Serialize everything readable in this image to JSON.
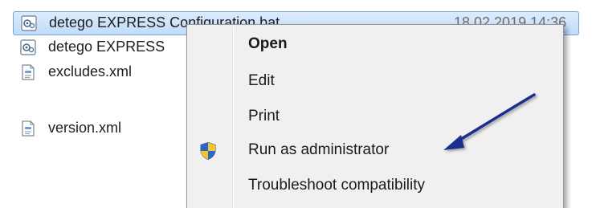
{
  "files": [
    {
      "name": "detego EXPRESS Configuration.bat",
      "date": "18.02.2019 14:36",
      "icon": "config-file-icon",
      "selected": true
    },
    {
      "name": "detego EXPRESS",
      "date": "",
      "icon": "config-file-icon",
      "selected": false
    },
    {
      "name": "excludes.xml",
      "date": "",
      "icon": "xml-file-icon",
      "selected": false
    },
    {
      "name": "version.xml",
      "date": "",
      "icon": "xml-file-icon",
      "selected": false
    }
  ],
  "context_menu": {
    "items": [
      {
        "label": "Open",
        "bold": true,
        "icon": ""
      },
      {
        "label": "Edit",
        "bold": false,
        "icon": ""
      },
      {
        "label": "Print",
        "bold": false,
        "icon": ""
      },
      {
        "label": "Run as administrator",
        "bold": false,
        "icon": "uac-shield-icon"
      },
      {
        "label": "Troubleshoot compatibility",
        "bold": false,
        "icon": ""
      }
    ]
  },
  "colors": {
    "selection_fill": "#c1dcfc",
    "selection_border": "#7da2ce",
    "menu_background": "#f0f0f0",
    "arrow": "#1f2f8f"
  }
}
